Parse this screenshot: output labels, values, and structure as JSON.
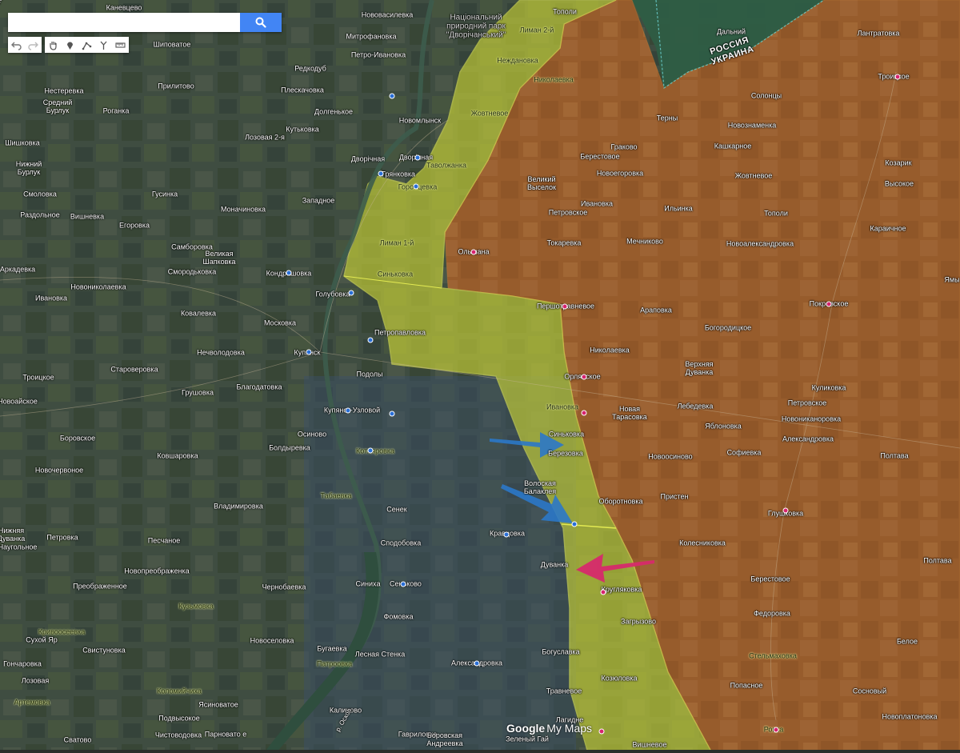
{
  "search": {
    "placeholder": "",
    "value": ""
  },
  "toolbar": {
    "undo_icon": "undo-icon",
    "redo_icon": "redo-icon",
    "hand_icon": "hand-icon",
    "marker_icon": "marker-icon",
    "line_icon": "draw-line-icon",
    "route_icon": "route-icon",
    "ruler_icon": "ruler-icon"
  },
  "colors": {
    "russia_zone": "#b0622a",
    "contested_zone": "#d4de36",
    "russia_territory": "#2b5a40",
    "ukraine_arrow": "#2b78c8",
    "russian_arrow": "#d62a6c"
  },
  "border_labels": [
    "РОССИЯ",
    "УКРАИНА"
  ],
  "park_label": "Національний\nприродний парк\n\"Дворічанський\"",
  "watermark": {
    "google": "Google",
    "mymaps": "My Maps"
  },
  "places": [
    {
      "name": "Каневцево",
      "style": "light"
    },
    {
      "name": "Нововасилевка",
      "style": "light"
    },
    {
      "name": "Тополи",
      "style": "light"
    },
    {
      "name": "Шиповатое",
      "style": "light"
    },
    {
      "name": "Митрофановка",
      "style": "light"
    },
    {
      "name": "Лиман 2-й",
      "style": "dark"
    },
    {
      "name": "Дальний",
      "style": "light"
    },
    {
      "name": "Лантратовка",
      "style": "light"
    },
    {
      "name": "Петро-Ивановка",
      "style": "light"
    },
    {
      "name": "Неждановка",
      "style": "dark"
    },
    {
      "name": "Николаевка",
      "style": "dark"
    },
    {
      "name": "Редкодуб",
      "style": "light"
    },
    {
      "name": "Троицкое",
      "style": "light"
    },
    {
      "name": "Нестерeвка",
      "style": "light"
    },
    {
      "name": "Плескачовка",
      "style": "light"
    },
    {
      "name": "Прилитово",
      "style": "light"
    },
    {
      "name": "Солонцы",
      "style": "light"
    },
    {
      "name": "Средний\nБурлук",
      "style": "light"
    },
    {
      "name": "Роганка",
      "style": "light"
    },
    {
      "name": "Долгенькое",
      "style": "light"
    },
    {
      "name": "Жовтневое",
      "style": "dark"
    },
    {
      "name": "Новомлынск",
      "style": "light"
    },
    {
      "name": "Терны",
      "style": "light"
    },
    {
      "name": "Новознаменка",
      "style": "light"
    },
    {
      "name": "Кутьковка",
      "style": "light"
    },
    {
      "name": "Лозовая 2-я",
      "style": "light"
    },
    {
      "name": "Шишковка",
      "style": "light"
    },
    {
      "name": "Граково",
      "style": "light"
    },
    {
      "name": "Кашкарное",
      "style": "light"
    },
    {
      "name": "Нижний\nБурлук",
      "style": "light"
    },
    {
      "name": "Дворічная",
      "style": "light"
    },
    {
      "name": "Дворічная",
      "style": "light"
    },
    {
      "name": "Таволжанка",
      "style": "dark"
    },
    {
      "name": "Берестовое",
      "style": "light"
    },
    {
      "name": "Козарик",
      "style": "light"
    },
    {
      "name": "Грянковка",
      "style": "light"
    },
    {
      "name": "Новоегоровка",
      "style": "light"
    },
    {
      "name": "Жовтневое",
      "style": "light"
    },
    {
      "name": "Горобцевка",
      "style": "dark"
    },
    {
      "name": "Смоловка",
      "style": "light"
    },
    {
      "name": "Гусинка",
      "style": "light"
    },
    {
      "name": "Великий\nВыселок",
      "style": "light"
    },
    {
      "name": "Высокое",
      "style": "light"
    },
    {
      "name": "Западное",
      "style": "light"
    },
    {
      "name": "Ивановка",
      "style": "light"
    },
    {
      "name": "Ильинка",
      "style": "light"
    },
    {
      "name": "Раздольное",
      "style": "light"
    },
    {
      "name": "Вишневка",
      "style": "light"
    },
    {
      "name": "Моначиновка",
      "style": "light"
    },
    {
      "name": "Петровское",
      "style": "light"
    },
    {
      "name": "Тополи",
      "style": "light"
    },
    {
      "name": "Егоровка",
      "style": "light"
    },
    {
      "name": "Лиман 1-й",
      "style": "dark"
    },
    {
      "name": "Токаревка",
      "style": "light"
    },
    {
      "name": "Мечниково",
      "style": "light"
    },
    {
      "name": "Новоалександровка",
      "style": "light"
    },
    {
      "name": "Карaичное",
      "style": "light"
    },
    {
      "name": "Самборовка",
      "style": "light"
    },
    {
      "name": "Великая\nШапковка",
      "style": "light"
    },
    {
      "name": "Ольшана",
      "style": "light"
    },
    {
      "name": "Аркадевка",
      "style": "light"
    },
    {
      "name": "Смородьковка",
      "style": "light"
    },
    {
      "name": "Кондрашовка",
      "style": "light"
    },
    {
      "name": "Синьковка",
      "style": "dark"
    },
    {
      "name": "Новониколаевка",
      "style": "light"
    },
    {
      "name": "Ямы",
      "style": "light"
    },
    {
      "name": "Голубовка",
      "style": "light"
    },
    {
      "name": "Ивановка",
      "style": "light"
    },
    {
      "name": "Першотравневое",
      "style": "light"
    },
    {
      "name": "Арaповка",
      "style": "light"
    },
    {
      "name": "Покровское",
      "style": "light"
    },
    {
      "name": "Ковалевка",
      "style": "light"
    },
    {
      "name": "Московка",
      "style": "light"
    },
    {
      "name": "Богородицкое",
      "style": "light"
    },
    {
      "name": "Петропавловка",
      "style": "light"
    },
    {
      "name": "Нечволодовка",
      "style": "light"
    },
    {
      "name": "Купянск",
      "style": "light"
    },
    {
      "name": "Николаевка",
      "style": "light"
    },
    {
      "name": "Верхняя\nДуванка",
      "style": "light"
    },
    {
      "name": "Старoверовка",
      "style": "light"
    },
    {
      "name": "Подолы",
      "style": "light"
    },
    {
      "name": "Орлянское",
      "style": "light"
    },
    {
      "name": "Троицкое",
      "style": "light"
    },
    {
      "name": "Благодатовка",
      "style": "light"
    },
    {
      "name": "Куликовка",
      "style": "light"
    },
    {
      "name": "Грушовка",
      "style": "light"
    },
    {
      "name": "Купянск-Узловой",
      "style": "light"
    },
    {
      "name": "Петровское",
      "style": "light"
    },
    {
      "name": "Ивановка",
      "style": "dark"
    },
    {
      "name": "Лебедевка",
      "style": "light"
    },
    {
      "name": "Новоайское",
      "style": "light"
    },
    {
      "name": "Новая\nТарасовка",
      "style": "light"
    },
    {
      "name": "Новониканоровка",
      "style": "light"
    },
    {
      "name": "Яблоновка",
      "style": "light"
    },
    {
      "name": "Осиново",
      "style": "light"
    },
    {
      "name": "Боровское",
      "style": "light"
    },
    {
      "name": "Александровка",
      "style": "light"
    },
    {
      "name": "Синьковка",
      "style": "light"
    },
    {
      "name": "Болдыревка",
      "style": "light"
    },
    {
      "name": "Ковшаровка",
      "style": "light"
    },
    {
      "name": "Котляровка",
      "style": "dark"
    },
    {
      "name": "Березовка",
      "style": "light"
    },
    {
      "name": "Новоосиново",
      "style": "light"
    },
    {
      "name": "Софиевка",
      "style": "light"
    },
    {
      "name": "Полтава",
      "style": "light"
    },
    {
      "name": "Новочервоное",
      "style": "light"
    },
    {
      "name": "Волоская\nБалаклея",
      "style": "light"
    },
    {
      "name": "Табаевка",
      "style": "dark"
    },
    {
      "name": "Пристен",
      "style": "light"
    },
    {
      "name": "Оборотновка",
      "style": "light"
    },
    {
      "name": "Владимировка",
      "style": "light"
    },
    {
      "name": "Сенек",
      "style": "light"
    },
    {
      "name": "Глушковка",
      "style": "light"
    },
    {
      "name": "Нижняя\nДуванка",
      "style": "light"
    },
    {
      "name": "Петровка",
      "style": "light"
    },
    {
      "name": "Кравцовка",
      "style": "light"
    },
    {
      "name": "Песчаное",
      "style": "light"
    },
    {
      "name": "Сподобовка",
      "style": "light"
    },
    {
      "name": "Колесниковка",
      "style": "light"
    },
    {
      "name": "Наугольное",
      "style": "light"
    },
    {
      "name": "Полтава",
      "style": "light"
    },
    {
      "name": "Новопреображенка",
      "style": "light"
    },
    {
      "name": "Дуванка",
      "style": "light"
    },
    {
      "name": "Берестовое",
      "style": "light"
    },
    {
      "name": "Преображенное",
      "style": "light"
    },
    {
      "name": "Чернобаевка",
      "style": "light"
    },
    {
      "name": "Синиха",
      "style": "light"
    },
    {
      "name": "Сеньково",
      "style": "light"
    },
    {
      "name": "Кругляковка",
      "style": "light"
    },
    {
      "name": "Кузьмовка",
      "style": "dark"
    },
    {
      "name": "Федоровка",
      "style": "light"
    },
    {
      "name": "Фомовка",
      "style": "light"
    },
    {
      "name": "Загрызово",
      "style": "light"
    },
    {
      "name": "Кривоосеевка",
      "style": "dark"
    },
    {
      "name": "Сухой Яр",
      "style": "light"
    },
    {
      "name": "Новоселовка",
      "style": "light"
    },
    {
      "name": "Белое",
      "style": "light"
    },
    {
      "name": "Свистуновка",
      "style": "light"
    },
    {
      "name": "Бугаевка",
      "style": "light"
    },
    {
      "name": "Лесная Стенка",
      "style": "light"
    },
    {
      "name": "Богуславка",
      "style": "light"
    },
    {
      "name": "Стельмаховка",
      "style": "dark"
    },
    {
      "name": "Гончаровка",
      "style": "light"
    },
    {
      "name": "Александровка",
      "style": "light"
    },
    {
      "name": "Лозовая",
      "style": "light"
    },
    {
      "name": "Козюловка",
      "style": "light"
    },
    {
      "name": "Коломийчиха",
      "style": "dark"
    },
    {
      "name": "Попасное",
      "style": "light"
    },
    {
      "name": "Сосновый",
      "style": "light"
    },
    {
      "name": "Травневое",
      "style": "light"
    },
    {
      "name": "Артемовка",
      "style": "dark"
    },
    {
      "name": "Подвысокое",
      "style": "light"
    },
    {
      "name": "Ясиноватое",
      "style": "light"
    },
    {
      "name": "Калиново",
      "style": "light"
    },
    {
      "name": "Новоплатоновка",
      "style": "light"
    },
    {
      "name": "Лагидне",
      "style": "light"
    },
    {
      "name": "Ровка",
      "style": "dark"
    },
    {
      "name": "Сватово",
      "style": "light"
    },
    {
      "name": "Чистоводовка",
      "style": "light"
    },
    {
      "name": "Парновато е",
      "style": "light"
    },
    {
      "name": "Гавриловка",
      "style": "light"
    },
    {
      "name": "Боровская\nАндреевка",
      "style": "light"
    },
    {
      "name": "Зеленый Гай",
      "style": "light"
    },
    {
      "name": "Вишневое",
      "style": "light"
    },
    {
      "name": "Патроовка",
      "style": "dark"
    },
    {
      "name": "р. Оскол",
      "style": "light"
    },
    {
      "name": "р. Оскол",
      "style": "light"
    }
  ],
  "markers": [
    {
      "type": "blue"
    },
    {
      "type": "blue"
    },
    {
      "type": "blue"
    },
    {
      "type": "blue"
    },
    {
      "type": "blue"
    },
    {
      "type": "blue"
    },
    {
      "type": "blue"
    },
    {
      "type": "blue"
    },
    {
      "type": "blue"
    },
    {
      "type": "blue"
    },
    {
      "type": "blue"
    },
    {
      "type": "blue"
    },
    {
      "type": "blue"
    },
    {
      "type": "blue"
    },
    {
      "type": "blue"
    },
    {
      "type": "pink"
    },
    {
      "type": "pink"
    },
    {
      "type": "pink"
    },
    {
      "type": "pink"
    },
    {
      "type": "pink"
    },
    {
      "type": "pink"
    },
    {
      "type": "pink"
    },
    {
      "type": "pink"
    },
    {
      "type": "pink"
    },
    {
      "type": "pink"
    }
  ]
}
